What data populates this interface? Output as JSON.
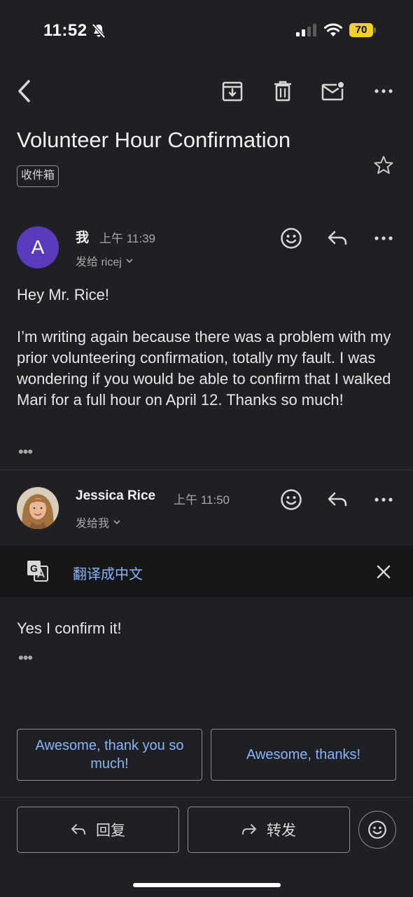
{
  "status_bar": {
    "time": "11:52",
    "battery": "70"
  },
  "toolbar": {
    "icons": [
      "back-arrow-icon",
      "archive-icon",
      "trash-icon",
      "mark-unread-icon",
      "more-icon"
    ]
  },
  "email": {
    "subject": "Volunteer Hour Confirmation",
    "label": "收件箱"
  },
  "messages": [
    {
      "avatar_letter": "A",
      "avatar_color": "#5b3bbd",
      "sender": "我",
      "time": "上午 11:39",
      "to": "发给 ricej",
      "greeting": "Hey Mr. Rice!",
      "body": "I’m writing again because there was a problem with my prior volunteering confirmation, totally my fault. I was wondering if you would be able to confirm that I walked Mari for a full hour on April 12. Thanks so much!",
      "ellipsis": "•••"
    },
    {
      "sender": "Jessica Rice",
      "time": "上午 11:50",
      "to": "发给我",
      "body": "Yes I confirm it!",
      "ellipsis": "•••"
    }
  ],
  "translate": {
    "label": "翻译成中文"
  },
  "smart_replies": [
    "Awesome, thank you so much!",
    "Awesome, thanks!"
  ],
  "actions": {
    "reply": "回复",
    "forward": "转发"
  },
  "colors": {
    "background": "#1f2023",
    "accent_link": "#8ab4f8",
    "battery": "#f2d02b",
    "avatar": "#5b3bbd"
  }
}
